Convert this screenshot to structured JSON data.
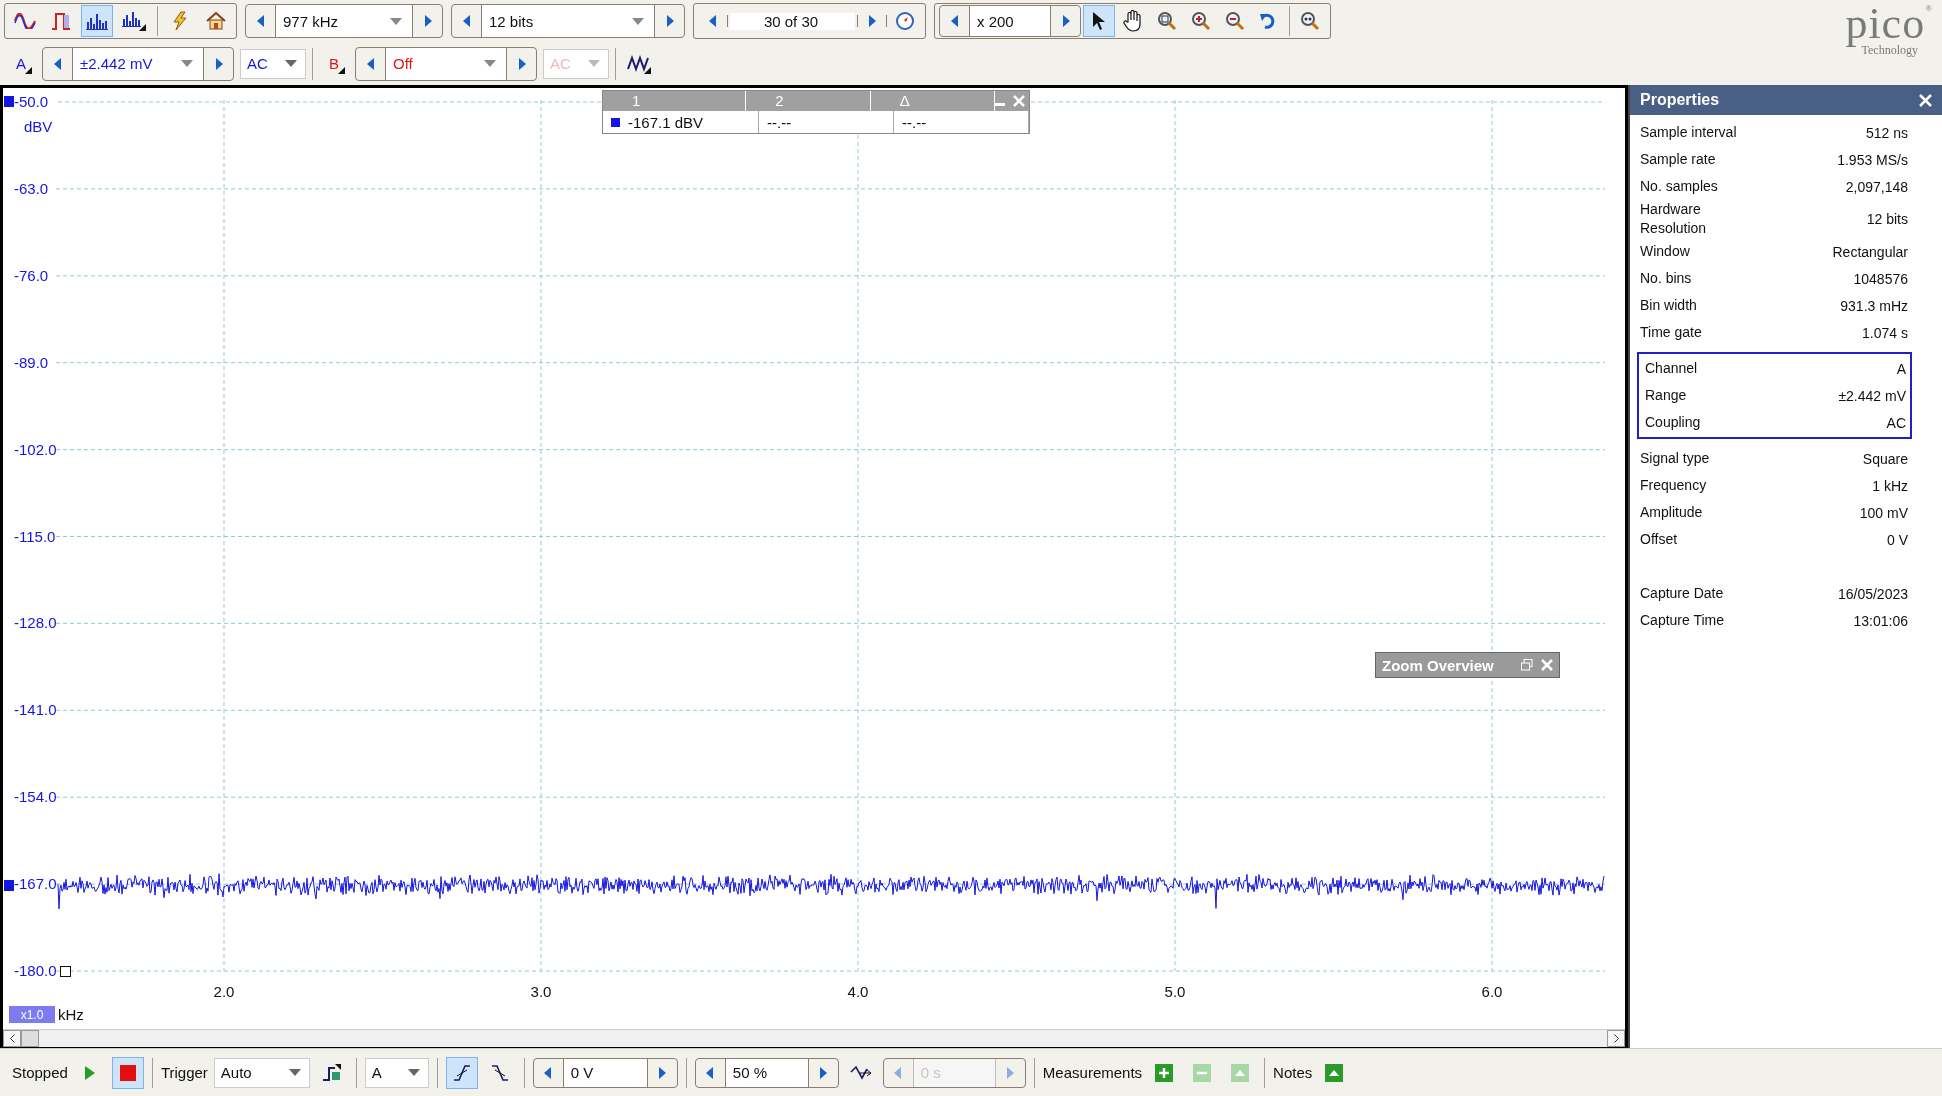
{
  "toolbar": {
    "mode_buttons": [
      {
        "kind": "scope",
        "selected": false
      },
      {
        "kind": "persistence",
        "selected": false
      },
      {
        "kind": "spectrum",
        "selected": true
      },
      {
        "kind": "spectrum_menu",
        "selected": false
      }
    ],
    "sample_rate": "977 kHz",
    "resolution": "12 bits",
    "buffer": "30 of 30",
    "zoom": "x 200",
    "canvas_tools": [
      {
        "kind": "pointer",
        "selected": true
      },
      {
        "kind": "hand",
        "selected": false
      },
      {
        "kind": "zoom_area",
        "selected": false
      },
      {
        "kind": "zoom_in",
        "selected": false
      },
      {
        "kind": "zoom_out",
        "selected": false
      },
      {
        "kind": "undo",
        "selected": false
      },
      {
        "kind": "zoom_100",
        "selected": false
      }
    ],
    "logo": {
      "name": "pico",
      "mark": "®",
      "tagline": "Technology"
    }
  },
  "channels": [
    {
      "name": "A",
      "range": "±2.442 mV",
      "coupling": "AC",
      "enabled": true,
      "color": "#1515e0"
    },
    {
      "name": "B",
      "range": "Off",
      "coupling": "AC",
      "enabled": false,
      "color": "#e01515"
    }
  ],
  "plot": {
    "y_labels": [
      "-50.0",
      "-63.0",
      "-76.0",
      "-89.0",
      "-102.0",
      "-115.0",
      "-128.0",
      "-141.0",
      "-154.0",
      "-167.0",
      "-180.0"
    ],
    "y_unit": "dBV",
    "x_labels": [
      "2.0",
      "3.0",
      "4.0",
      "5.0",
      "6.0"
    ],
    "x_unit": "kHz",
    "scale_badge": "x1.0"
  },
  "cursor_table": {
    "headers": [
      "1",
      "2",
      "Δ"
    ],
    "rows": [
      {
        "color": "#1515e0",
        "values": [
          "-167.1 dBV",
          "--.--",
          "--.--"
        ]
      }
    ]
  },
  "zoom_overview": {
    "title": "Zoom Overview"
  },
  "properties": {
    "title": "Properties",
    "groups": [
      {
        "boxed": false,
        "rows": [
          {
            "label": "Sample interval",
            "value": "512 ns"
          },
          {
            "label": "Sample rate",
            "value": "1.953 MS/s"
          },
          {
            "label": "No. samples",
            "value": "2,097,148"
          },
          {
            "label": "Hardware\nResolution",
            "value": "12 bits"
          },
          {
            "label": "Window",
            "value": "Rectangular"
          },
          {
            "label": "No. bins",
            "value": "1048576"
          },
          {
            "label": "Bin width",
            "value": "931.3 mHz"
          },
          {
            "label": "Time gate",
            "value": "1.074 s"
          }
        ]
      },
      {
        "boxed": true,
        "rows": [
          {
            "label": "Channel",
            "value": "A"
          },
          {
            "label": "Range",
            "value": "±2.442 mV"
          },
          {
            "label": "Coupling",
            "value": "AC"
          }
        ]
      },
      {
        "boxed": false,
        "rows": [
          {
            "label": "Signal type",
            "value": "Square"
          },
          {
            "label": "Frequency",
            "value": "1 kHz"
          },
          {
            "label": "Amplitude",
            "value": "100 mV"
          },
          {
            "label": "Offset",
            "value": "0 V"
          }
        ]
      },
      {
        "boxed": false,
        "rows": [
          {
            "label": "Capture Date",
            "value": "16/05/2023"
          },
          {
            "label": "Capture Time",
            "value": "13:01:06"
          }
        ]
      }
    ]
  },
  "status_bar": {
    "run_state": "Stopped",
    "running": false,
    "trigger_label": "Trigger",
    "trigger_mode": "Auto",
    "trigger_source": "A",
    "edges": [
      {
        "kind": "rising",
        "selected": true
      },
      {
        "kind": "falling",
        "selected": false
      }
    ],
    "threshold": "0 V",
    "pretrigger": "50 %",
    "delay": "0 s",
    "delay_enabled": false,
    "measurements_label": "Measurements",
    "notes_label": "Notes"
  }
}
